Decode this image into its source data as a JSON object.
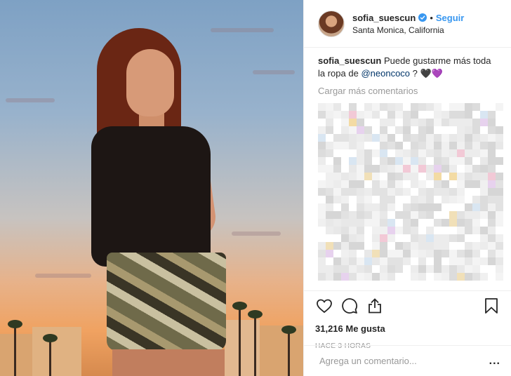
{
  "post": {
    "username": "sofia_suescun",
    "separator": "•",
    "follow_label": "Seguir",
    "location": "Santa Monica, California",
    "caption": {
      "username": "sofia_suescun",
      "text_before": "Puede gustarme más toda la ropa de",
      "mention": "@neoncoco",
      "text_after": "?",
      "emoji": "🖤💜"
    },
    "load_more_label": "Cargar más comentarios",
    "likes": "31,216 Me gusta",
    "time": "HACE 3 HORAS",
    "comment_placeholder": "Agrega un comentario...",
    "more_label": "..."
  },
  "icons": {
    "like": "heart-icon",
    "comment": "comment-icon",
    "share": "share-icon",
    "save": "bookmark-icon",
    "verified": "verified-badge-icon"
  },
  "colors": {
    "link_blue": "#3897f0",
    "mention": "#003569",
    "text": "#262626",
    "muted": "#999999",
    "border": "#efefef"
  }
}
